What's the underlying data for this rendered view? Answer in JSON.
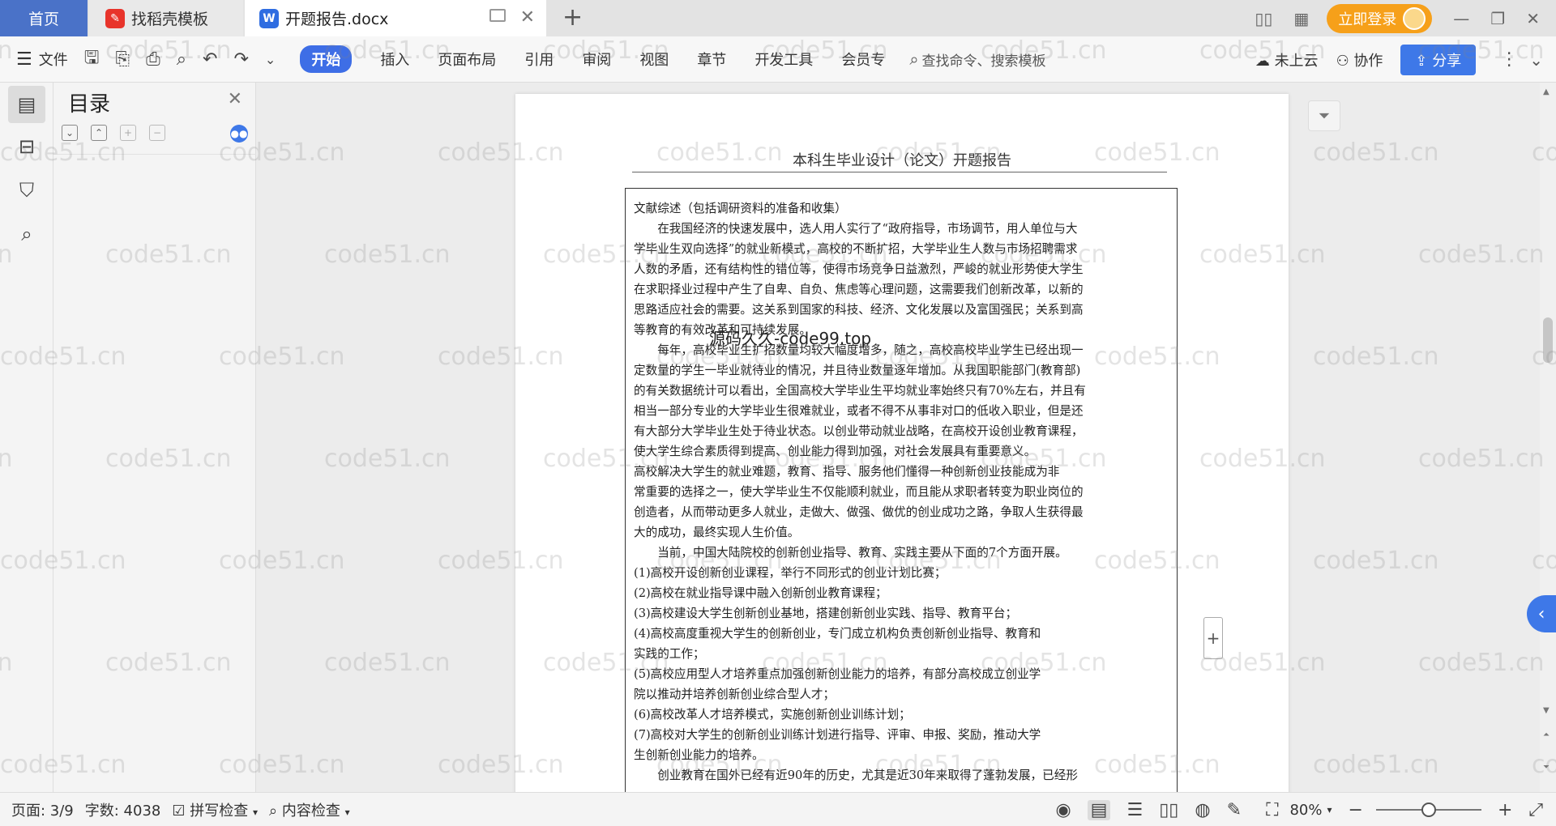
{
  "tabs": {
    "home": "首页",
    "template": "找稻壳模板",
    "doc": "开题报告.docx"
  },
  "header_right": {
    "login": "立即登录"
  },
  "ribbon": {
    "file": "文件",
    "tabs": [
      "开始",
      "插入",
      "页面布局",
      "引用",
      "审阅",
      "视图",
      "章节",
      "开发工具",
      "会员专"
    ],
    "search": "查找命令、搜索模板",
    "cloud": "未上云",
    "collab": "协作",
    "share": "分享"
  },
  "toc": {
    "title": "目录"
  },
  "document": {
    "header": "本科生毕业设计（论文）开题报告",
    "overlay_text": "源码久久-code99.top",
    "lines": [
      "文献综述（包括调研资料的准备和收集）",
      "　　在我国经济的快速发展中，选人用人实行了“政府指导，市场调节，用人单位与大",
      "学毕业生双向选择”的就业新模式，高校的不断扩招，大学毕业生人数与市场招聘需求",
      "人数的矛盾，还有结构性的错位等，使得市场竞争日益激烈，严峻的就业形势使大学生",
      "在求职择业过程中产生了自卑、自负、焦虑等心理问题，这需要我们创新改革，以新的",
      "思路适应社会的需要。这关系到国家的科技、经济、文化发展以及富国强民；关系到高",
      "等教育的有效改革和可持续发展。",
      "　　每年，高校毕业生扩招数量均较大幅度增多，随之，高校高校毕业学生已经出现一",
      "定数量的学生一毕业就待业的情况，并且待业数量逐年增加。从我国职能部门(教育部)",
      "的有关数据统计可以看出，全国高校大学毕业生平均就业率始终只有70%左右，并且有",
      "相当一部分专业的大学毕业生很难就业，或者不得不从事非对口的低收入职业，但是还",
      "有大部分大学毕业生处于待业状态。以创业带动就业战略，在高校开设创业教育课程，",
      "使大学生综合素质得到提高、创业能力得到加强，对社会发展具有重要意义。",
      "高校解决大学生的就业难题，教育、指导、服务他们懂得一种创新创业技能成为非",
      "常重要的选择之一，使大学毕业生不仅能顺利就业，而且能从求职者转变为职业岗位的",
      "创造者，从而带动更多人就业，走做大、做强、做优的创业成功之路，争取人生获得最",
      "大的成功，最终实现人生价值。",
      "　　当前，中国大陆院校的创新创业指导、教育、实践主要从下面的7个方面开展。",
      "(1)高校开设创新创业课程，举行不同形式的创业计划比赛；",
      "(2)高校在就业指导课中融入创新创业教育课程；",
      "(3)高校建设大学生创新创业基地，搭建创新创业实践、指导、教育平台；",
      "(4)高校高度重视大学生的创新创业，专门成立机构负责创新创业指导、教育和",
      "实践的工作；",
      "(5)高校应用型人才培养重点加强创新创业能力的培养，有部分高校成立创业学",
      "院以推动并培养创新创业综合型人才；",
      "(6)高校改革人才培养模式，实施创新创业训练计划；",
      "(7)高校对大学生的创新创业训练计划进行指导、评审、申报、奖励，推动大学",
      "生创新创业能力的培养。",
      "　　创业教育在国外已经有近90年的历史，尤其是近30年来取得了蓬勃发展，已经形"
    ]
  },
  "status": {
    "page": "页面: 3/9",
    "words": "字数: 4038",
    "spell": "拼写检查",
    "content_check": "内容检查",
    "zoom": "80%",
    "zoom_fraction": 0.5
  },
  "watermark": "code51.cn",
  "colors": {
    "accent": "#3e78e8",
    "home_tab": "#4a72c8",
    "login": "#f6a01a"
  }
}
